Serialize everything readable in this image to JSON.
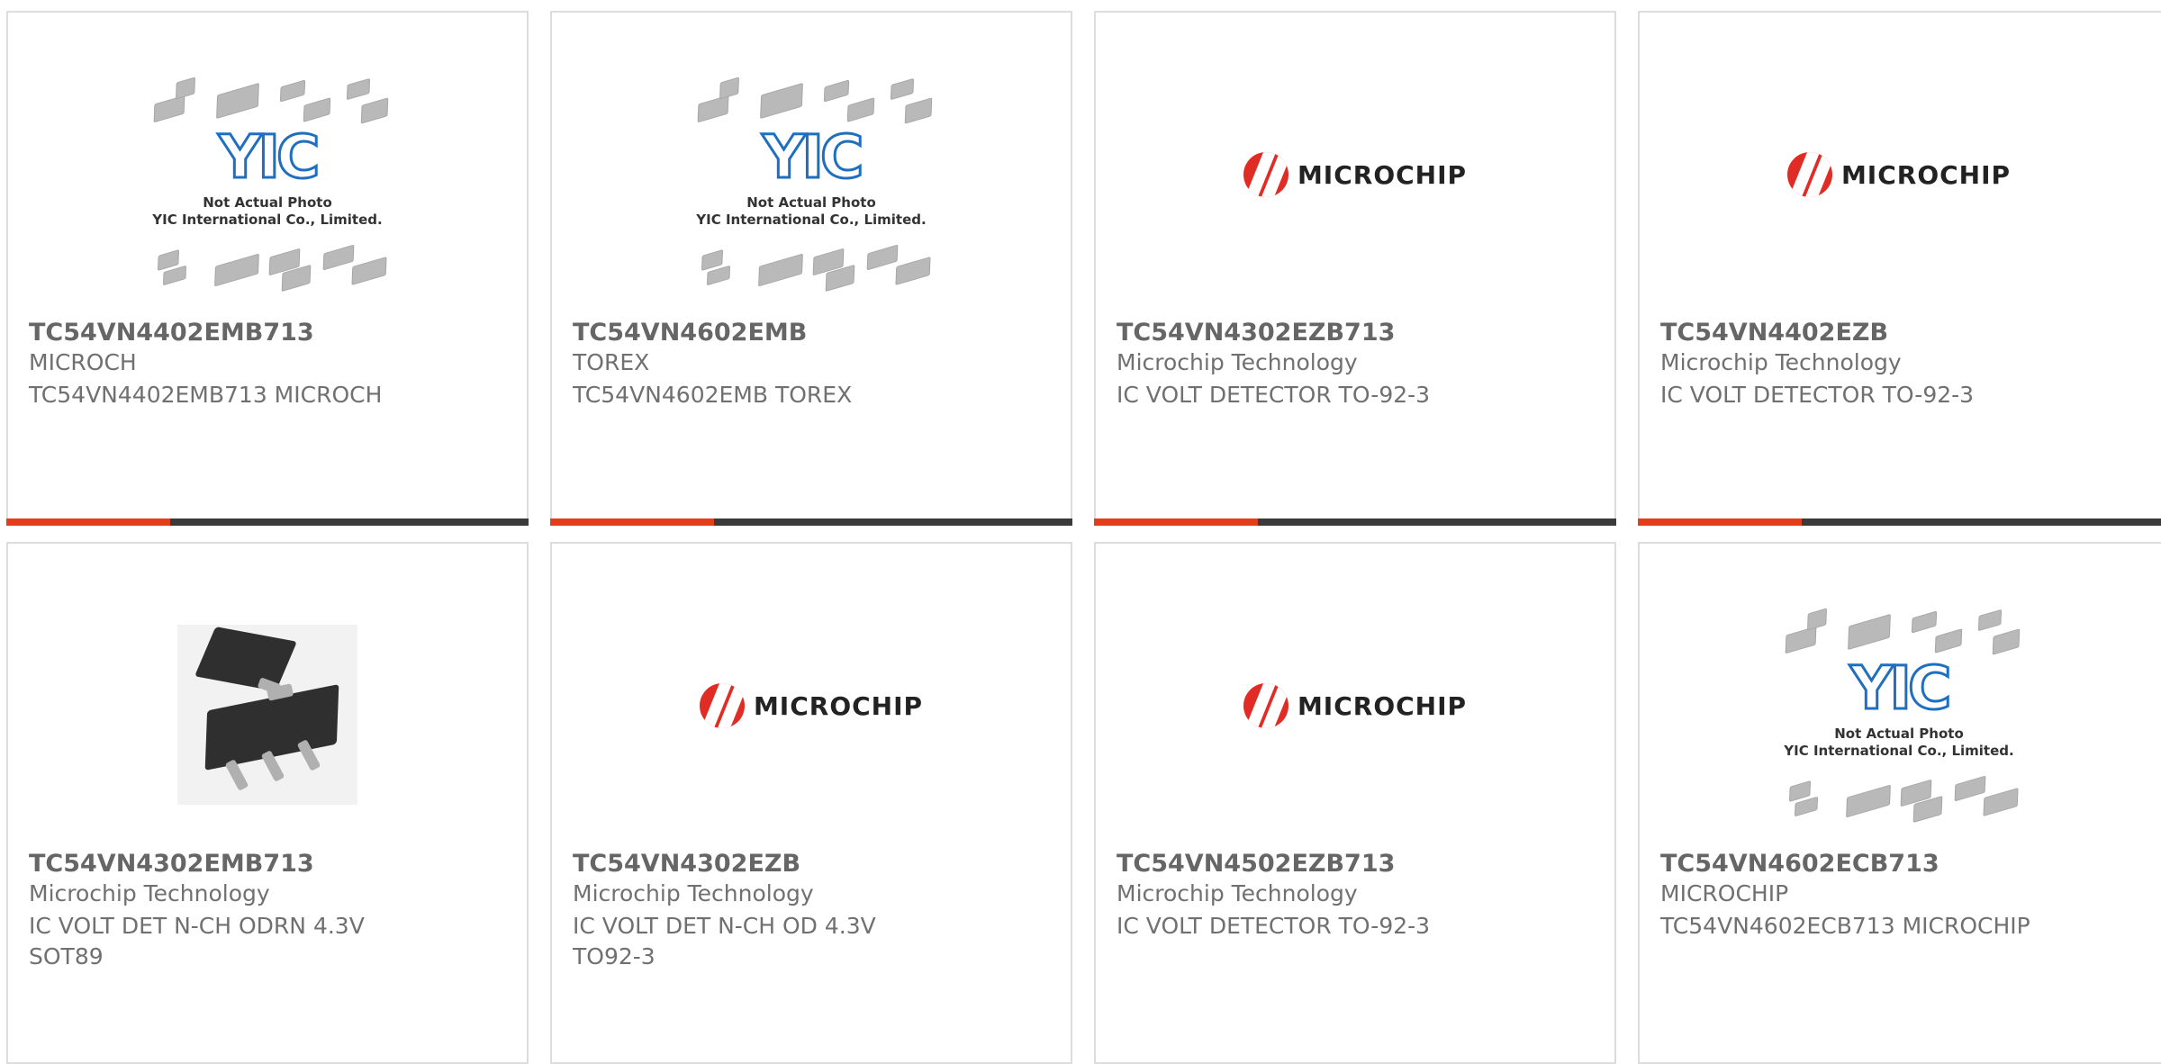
{
  "products": [
    {
      "part": "TC54VN4402EMB713",
      "manufacturer": "MICROCH",
      "description": "TC54VN4402EMB713 MICROCH",
      "image": "yic-placeholder"
    },
    {
      "part": "TC54VN4602EMB",
      "manufacturer": "TOREX",
      "description": "TC54VN4602EMB TOREX",
      "image": "yic-placeholder"
    },
    {
      "part": "TC54VN4302EZB713",
      "manufacturer": "Microchip Technology",
      "description": "IC VOLT DETECTOR TO-92-3",
      "image": "microchip-logo"
    },
    {
      "part": "TC54VN4402EZB",
      "manufacturer": "Microchip Technology",
      "description": "IC VOLT DETECTOR TO-92-3",
      "image": "microchip-logo"
    },
    {
      "part": "TC54VN4302EMB713",
      "manufacturer": "Microchip Technology",
      "description": "IC VOLT DET N-CH ODRN 4.3V SOT89",
      "image": "sot89-photo"
    },
    {
      "part": "TC54VN4302EZB",
      "manufacturer": "Microchip Technology",
      "description": "IC VOLT DET N-CH OD 4.3V TO92-3",
      "image": "microchip-logo"
    },
    {
      "part": "TC54VN4502EZB713",
      "manufacturer": "Microchip Technology",
      "description": "IC VOLT DETECTOR TO-92-3",
      "image": "microchip-logo"
    },
    {
      "part": "TC54VN4602ECB713",
      "manufacturer": "MICROCHIP",
      "description": "TC54VN4602ECB713 MICROCHIP",
      "image": "yic-placeholder"
    }
  ],
  "placeholder": {
    "brand": "YIC",
    "line1": "Not Actual Photo",
    "line2": "YIC International Co., Limited."
  },
  "microchip_logo": {
    "wordmark": "MICROCHIP"
  },
  "colors": {
    "accent": "#e43d1a",
    "bar": "#3a3a3a",
    "border": "#dddddd",
    "text": "#666666",
    "microchip_red": "#e02c25",
    "yic_blue": "#1e6fc0"
  }
}
